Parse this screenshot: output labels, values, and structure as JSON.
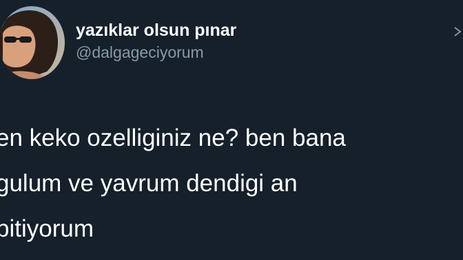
{
  "user": {
    "display_name": "yazıklar olsun pınar",
    "handle": "@dalgageciyorum",
    "avatar_icon": "profile-photo"
  },
  "tweet": {
    "lines": [
      "en keko ozelliginiz ne? ben bana",
      "gulum ve yavrum dendigi an",
      "bitiyorum"
    ]
  },
  "colors": {
    "background": "#15202b",
    "text": "#ffffff",
    "muted": "#8899a6"
  }
}
